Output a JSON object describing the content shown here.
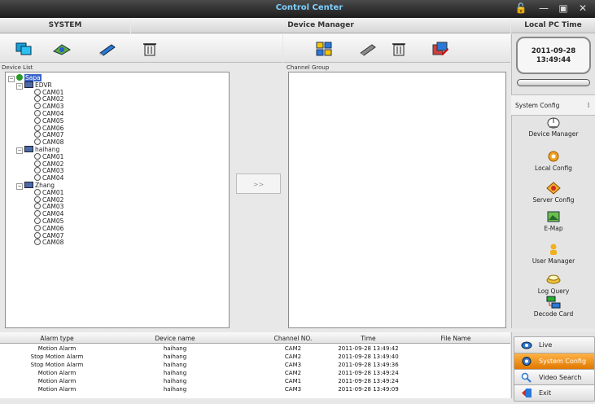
{
  "window": {
    "title": "Control Center"
  },
  "header": {
    "left": "SYSTEM",
    "center": "Device Manager",
    "right": "Local PC Time"
  },
  "clock": {
    "date": "2011-09-28",
    "time": "13:49:44"
  },
  "device_list": {
    "label": "Device List",
    "root": "Sapa",
    "devices": [
      {
        "name": "EDVR",
        "cams": [
          "CAM01",
          "CAM02",
          "CAM03",
          "CAM04",
          "CAM05",
          "CAM06",
          "CAM07",
          "CAM08"
        ]
      },
      {
        "name": "haihang",
        "cams": [
          "CAM01",
          "CAM02",
          "CAM03",
          "CAM04"
        ]
      },
      {
        "name": "Zhang",
        "cams": [
          "CAM01",
          "CAM02",
          "CAM03",
          "CAM04",
          "CAM05",
          "CAM06",
          "CAM07",
          "CAM08"
        ]
      }
    ]
  },
  "channel_group": {
    "label": "Channel Group"
  },
  "transfer_button": ">>",
  "sidebar": {
    "section": "System Config",
    "items": [
      "Device Manager",
      "Local Config",
      "Server Config",
      "E-Map",
      "User Manager",
      "Log Query",
      "Decode Card"
    ]
  },
  "alarm_table": {
    "columns": [
      "Alarm type",
      "Device name",
      "Channel NO.",
      "Time",
      "File Name"
    ],
    "rows": [
      [
        "Motion Alarm",
        "haihang",
        "CAM2",
        "2011-09-28 13:49:42",
        ""
      ],
      [
        "Stop Motion Alarm",
        "haihang",
        "CAM2",
        "2011-09-28 13:49:40",
        ""
      ],
      [
        "Stop Motion Alarm",
        "haihang",
        "CAM3",
        "2011-09-28 13:49:36",
        ""
      ],
      [
        "Motion Alarm",
        "haihang",
        "CAM2",
        "2011-09-28 13:49:24",
        ""
      ],
      [
        "Motion Alarm",
        "haihang",
        "CAM1",
        "2011-09-28 13:49:24",
        ""
      ],
      [
        "Motion Alarm",
        "haihang",
        "CAM3",
        "2011-09-28 13:49:09",
        ""
      ]
    ]
  },
  "nav": [
    "Live",
    "System Config",
    "Video Search",
    "Exit"
  ],
  "colors": {
    "accent": "#e07800",
    "selection": "#3a64c8",
    "title_text": "#7fd0ff"
  }
}
